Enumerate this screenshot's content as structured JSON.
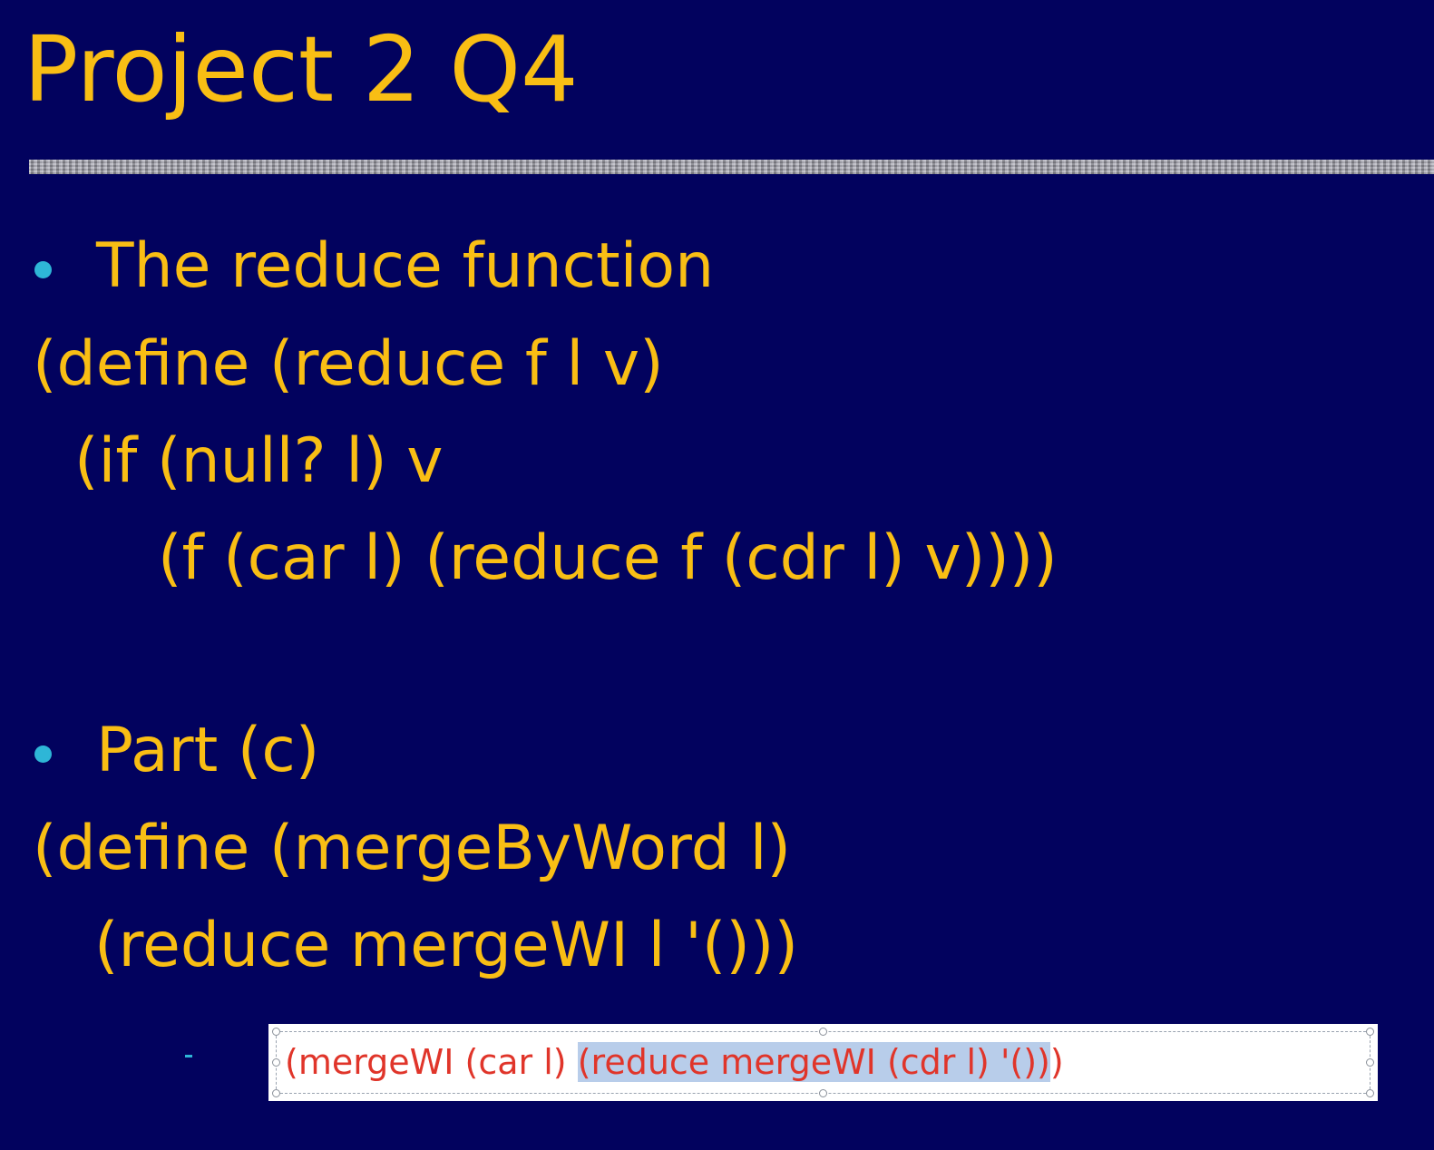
{
  "colors": {
    "background": "#02025e",
    "text": "#f9be14",
    "bullet": "#2eb6d7",
    "code_red": "#e0352a",
    "selection": "#b8cdea"
  },
  "slide": {
    "title": "Project 2 Q4",
    "bullets": [
      {
        "text": "The reduce function"
      },
      {
        "text": "Part (c)"
      }
    ],
    "code_block_1": [
      "(define (reduce f l v)",
      "(if (null? l) v",
      "(f (car l) (reduce f (cdr l) v))))"
    ],
    "code_block_2": [
      "(define (mergeByWord l)",
      "(reduce mergeWI l '()))"
    ]
  },
  "textbox": {
    "before_selection": "(mergeWI (car l) ",
    "selected": "(reduce mergeWI (cdr l) '())",
    "after_selection": ")"
  }
}
